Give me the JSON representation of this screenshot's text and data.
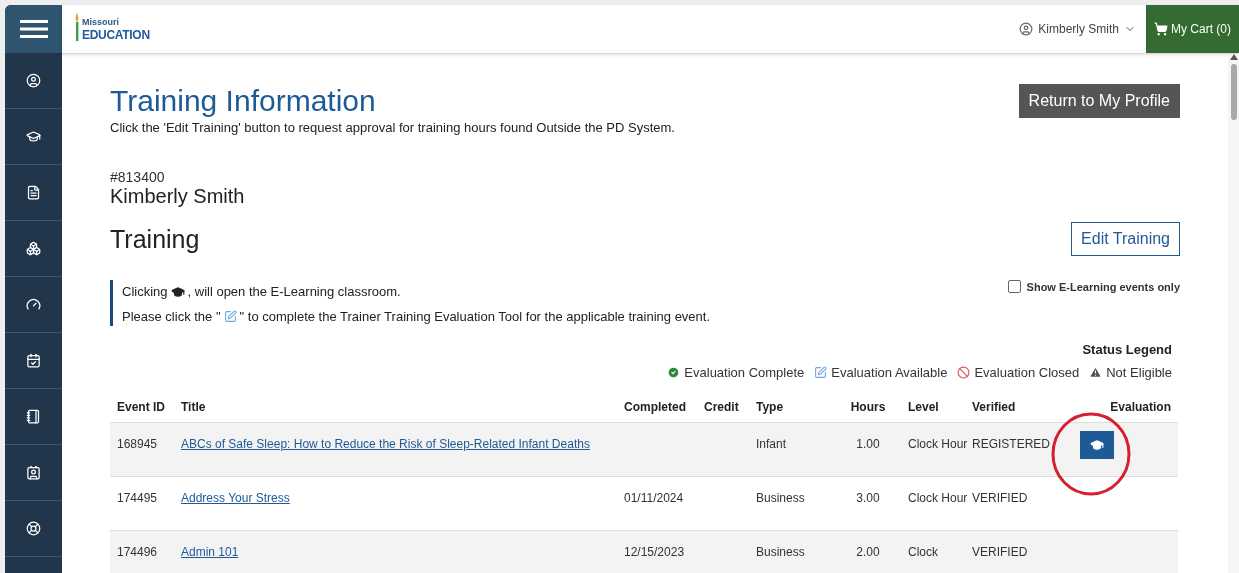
{
  "header": {
    "logo": {
      "state": "Missouri",
      "wordmark": "EDUCATION"
    },
    "user": "Kimberly Smith",
    "cart": "My Cart (0)"
  },
  "page": {
    "title": "Training Information",
    "subtitle": "Click the 'Edit Training' button to request approval for training hours found Outside the PD System.",
    "return_button": "Return to My Profile",
    "person_id": "#813400",
    "person_name": "Kimberly Smith",
    "section_title": "Training",
    "edit_button": "Edit Training"
  },
  "notice": {
    "line_1": {
      "before": "Clicking",
      "after": ", will open the E-Learning classroom."
    },
    "line_2": {
      "before": "Please click the \"",
      "after": "\" to complete the Trainer Training Evaluation Tool for the applicable training event."
    }
  },
  "filter": {
    "label": "Show E-Learning events only",
    "checked": false
  },
  "legend": {
    "title": "Status Legend",
    "items": [
      {
        "kind": "complete",
        "label": "Evaluation Complete"
      },
      {
        "kind": "available",
        "label": "Evaluation Available"
      },
      {
        "kind": "closed",
        "label": "Evaluation Closed"
      },
      {
        "kind": "not_eligible",
        "label": "Not Eligible"
      }
    ]
  },
  "table": {
    "columns": [
      "Event ID",
      "Title",
      "Completed",
      "Credit",
      "Type",
      "Hours",
      "Level",
      "Verified",
      "Evaluation"
    ],
    "rows": [
      {
        "event_id": "168945",
        "title": "ABCs of Safe Sleep: How to Reduce the Risk of Sleep-Related Infant Deaths",
        "completed": "",
        "credit": "",
        "type": "Infant",
        "hours": "1.00",
        "level": "Clock Hour",
        "verified": "REGISTERED",
        "elearning_button": true,
        "highlighted": true
      },
      {
        "event_id": "174495",
        "title": "Address Your Stress",
        "completed": "01/11/2024",
        "credit": "",
        "type": "Business",
        "hours": "3.00",
        "level": "Clock Hour",
        "verified": "VERIFIED",
        "elearning_button": false,
        "highlighted": false
      },
      {
        "event_id": "174496",
        "title": "Admin 101",
        "completed": "12/15/2023",
        "credit": "",
        "type": "Business",
        "hours": "2.00",
        "level": "Clock",
        "verified": "VERIFIED",
        "elearning_button": false,
        "highlighted": false
      }
    ]
  }
}
